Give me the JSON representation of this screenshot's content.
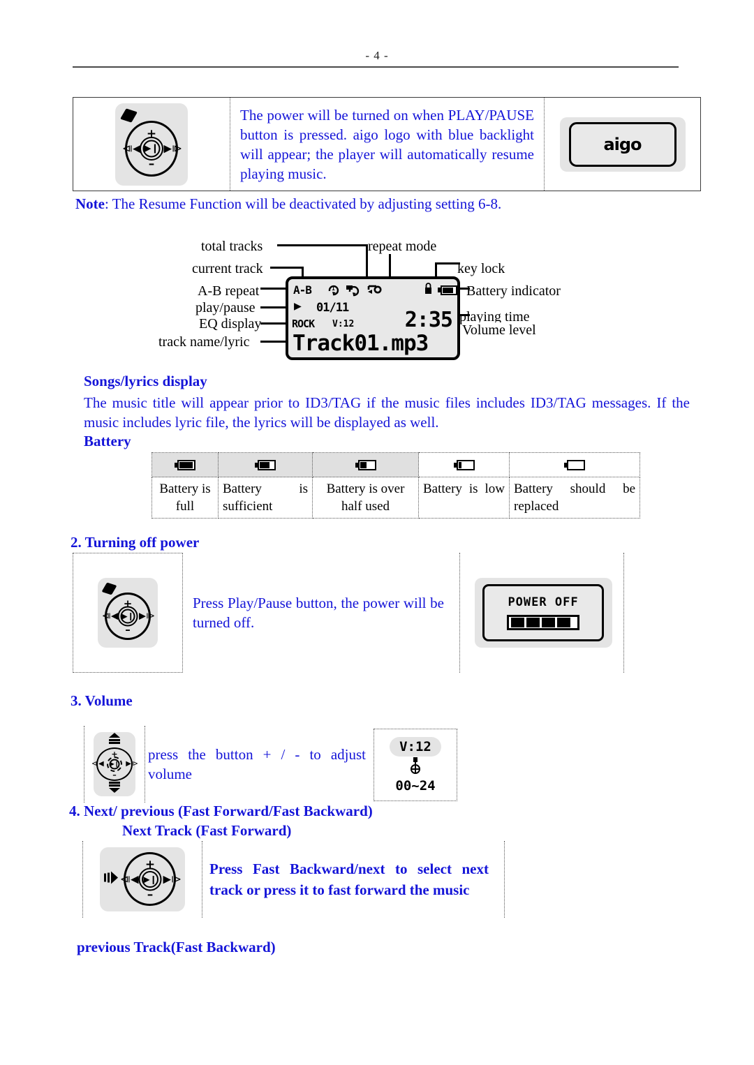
{
  "page": {
    "number_label": "- 4 -"
  },
  "power_on": {
    "body": "The power will be turned on when PLAY/PAUSE button is pressed. aigo logo with blue backlight will appear; the player will automatically resume playing music.",
    "logo_text": "aigo",
    "wheel": {
      "plus": "+",
      "minus": "–",
      "prev": "⧏◀",
      "next": "▶⧐",
      "play_pause": "▶❙"
    }
  },
  "note": {
    "label": "Note",
    "separator": ": ",
    "text": "The Resume Function will be deactivated by adjusting setting 6-8."
  },
  "diagram": {
    "labels": {
      "total_tracks": "total tracks",
      "current_track": "current track",
      "ab_repeat": "A-B repeat",
      "play_pause": "play/pause",
      "eq_display": "EQ display",
      "track_name_lyric": "track name/lyric",
      "repeat_mode": "repeat mode",
      "key_lock": "key lock",
      "battery_indicator": "Battery indicator",
      "playing_time": "playing time",
      "volume_level": "Volume level"
    },
    "lcd": {
      "ab": "A-B",
      "play_glyph": "▶",
      "track_counter": "01/11",
      "eq": "ROCK",
      "volume": "V:12",
      "time": "2:35",
      "track_name": "Track01.mp3",
      "lock_glyph": "ॐ",
      "repeat_icons": [
        "repeat-one-icon",
        "repeat-folder-icon",
        "repeat-all-icon"
      ]
    }
  },
  "songs": {
    "heading": "Songs/lyrics display",
    "body": "The music title will appear prior to ID3/TAG if the music files includes ID3/TAG messages. If the music includes lyric file, the lyrics will be displayed as well."
  },
  "battery": {
    "heading": "Battery",
    "levels": [
      {
        "icon": "battery-full-icon",
        "fill": 100,
        "header_shaded": true,
        "label": "Battery is full",
        "justify": "justify"
      },
      {
        "icon": "battery-high-icon",
        "fill": 75,
        "header_shaded": true,
        "label": "Battery is sufficient",
        "justify": "justify"
      },
      {
        "icon": "battery-half-icon",
        "fill": 45,
        "header_shaded": true,
        "label": "Battery is over half used",
        "justify": "center"
      },
      {
        "icon": "battery-low-icon",
        "fill": 20,
        "header_shaded": false,
        "label": "Battery is low",
        "justify": "justify"
      },
      {
        "icon": "battery-empty-icon",
        "fill": 0,
        "header_shaded": false,
        "label": "Battery should be replaced",
        "justify": "justify"
      }
    ]
  },
  "turning_off": {
    "heading": "2. Turning off power",
    "body": "Press Play/Pause button, the power will be turned off.",
    "screen": {
      "text": "POWER OFF",
      "segments": 4
    }
  },
  "volume": {
    "heading": "3. Volume",
    "body": "press the button + / - to adjust volume",
    "screen": {
      "value": "V:12",
      "range": "00~24"
    }
  },
  "next_previous": {
    "heading": "4. Next/ previous (Fast Forward/Fast Backward)",
    "subheading": "Next Track (Fast Forward)",
    "body": "Press Fast Backward/next to select next track or press it to fast forward the music",
    "previous_heading": "previous Track(Fast Backward)"
  }
}
